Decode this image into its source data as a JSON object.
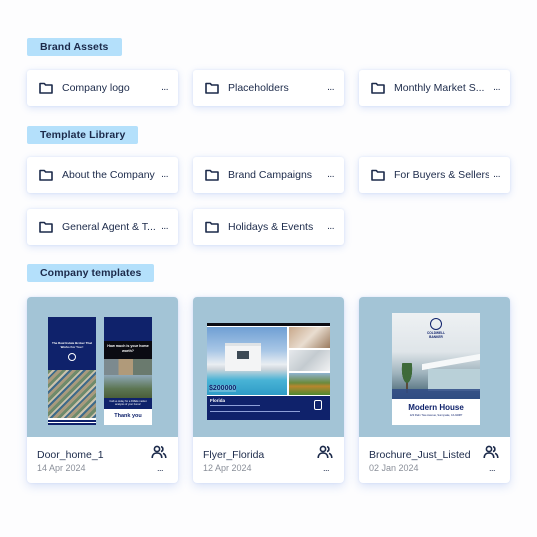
{
  "sections": {
    "brand_assets": {
      "label": "Brand Assets",
      "folders": [
        {
          "name": "Company logo",
          "icon": "folder-icon",
          "more": "..."
        },
        {
          "name": "Placeholders",
          "icon": "folder-icon",
          "more": "..."
        },
        {
          "name": "Monthly Market S...",
          "icon": "folder-icon",
          "more": "..."
        }
      ]
    },
    "template_library": {
      "label": "Template Library",
      "folders": [
        {
          "name": "About the Company",
          "icon": "folder-icon",
          "more": "..."
        },
        {
          "name": "Brand Campaigns",
          "icon": "folder-icon",
          "more": "..."
        },
        {
          "name": "For Buyers & Sellers",
          "icon": "folder-icon",
          "more": "..."
        },
        {
          "name": "General Agent & T...",
          "icon": "folder-icon",
          "more": "..."
        },
        {
          "name": "Holidays & Events",
          "icon": "folder-icon",
          "more": "..."
        }
      ]
    },
    "company_templates": {
      "label": "Company templates",
      "templates": [
        {
          "name": "Door_home_1",
          "date": "14 Apr 2024",
          "icon": "share-users-icon",
          "more": "...",
          "preview": {
            "left_headline": "The Real Estate Broker That Works For You !",
            "right_headline": "How much is your home worth?",
            "right_cta": "Call us today for a FREE market analysis of your home!",
            "right_footer": "Thank you"
          }
        },
        {
          "name": "Flyer_Florida",
          "date": "12 Apr 2024",
          "icon": "share-users-icon",
          "more": "...",
          "preview": {
            "price": "$200000",
            "location": "Florida"
          }
        },
        {
          "name": "Brochure_Just_Listed",
          "date": "02 Jan 2024",
          "icon": "share-users-icon",
          "more": "...",
          "preview": {
            "brand_line1": "COLDWELL",
            "brand_line2": "BANKER",
            "title": "Modern House",
            "address": "123 Palm Tree Avenue, Sunnyvale, CA 94087"
          }
        }
      ]
    }
  },
  "colors": {
    "label_bg": "#b4e0fb",
    "text_primary": "#1c2a4a",
    "text_muted": "#8a8f99",
    "thumb_bg": "#a3c4d6",
    "brand_navy": "#0f226b"
  }
}
